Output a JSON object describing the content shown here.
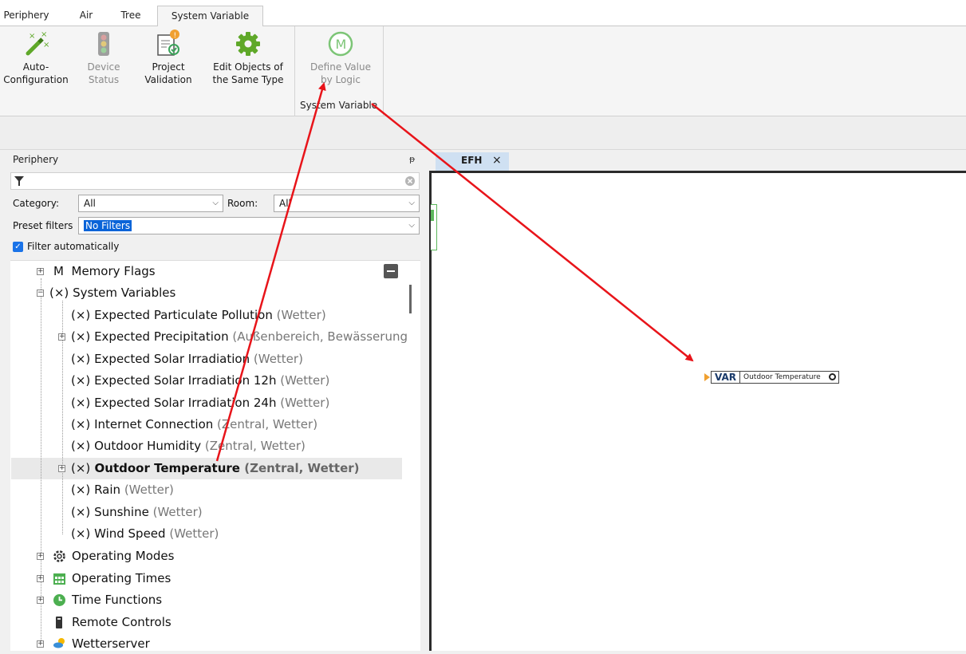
{
  "ribbon": {
    "tabs": [
      "Periphery",
      "Air",
      "Tree",
      "System Variable"
    ],
    "active_tab": "System Variable",
    "buttons": [
      {
        "label1": "Auto-",
        "label2": "Configuration",
        "icon": "magic-wand-icon",
        "enabled": true
      },
      {
        "label1": "Device",
        "label2": "Status",
        "icon": "traffic-light-icon",
        "enabled": false
      },
      {
        "label1": "Project",
        "label2": "Validation",
        "icon": "validation-icon",
        "enabled": true
      },
      {
        "label1": "Edit Objects of",
        "label2": "the Same Type",
        "icon": "gear-icon",
        "enabled": true
      },
      {
        "label1": "Define Value",
        "label2": "by Logic",
        "icon": "logic-m-icon",
        "enabled": false
      }
    ],
    "group_label": "System Variable",
    "colors": {
      "gear_green": "#5fa829",
      "logic_green": "#7cc576",
      "tab_highlight": "#cfe0f2"
    }
  },
  "periphery": {
    "title": "Periphery",
    "pin_icon": "pin-icon",
    "filter_icon": "funnel-icon",
    "clear_icon": "clear-circle-icon",
    "category_label": "Category:",
    "category_value": "All",
    "room_label": "Room:",
    "room_value": "All",
    "preset_label": "Preset filters",
    "preset_value": "No Filters",
    "filter_auto_label": "Filter automatically",
    "filter_auto_checked": true
  },
  "tree": {
    "memory_flags": "Memory Flags",
    "system_variables": "System Variables",
    "children": [
      {
        "name": "Expected Particulate Pollution",
        "ctx": "(Wetter)",
        "expandable": false
      },
      {
        "name": "Expected Precipitation",
        "ctx": "(Außenbereich, Bewässerung",
        "expandable": true
      },
      {
        "name": "Expected Solar Irradiation",
        "ctx": "(Wetter)",
        "expandable": false
      },
      {
        "name": "Expected Solar Irradiation 12h",
        "ctx": "(Wetter)",
        "expandable": false
      },
      {
        "name": "Expected Solar Irradiation 24h",
        "ctx": "(Wetter)",
        "expandable": false
      },
      {
        "name": "Internet Connection",
        "ctx": "(Zentral, Wetter)",
        "expandable": false
      },
      {
        "name": "Outdoor Humidity",
        "ctx": "(Zentral, Wetter)",
        "expandable": false
      },
      {
        "name": "Outdoor Temperature",
        "ctx": "(Zentral, Wetter)",
        "expandable": true,
        "selected": true
      },
      {
        "name": "Rain",
        "ctx": "(Wetter)",
        "expandable": false
      },
      {
        "name": "Sunshine",
        "ctx": "(Wetter)",
        "expandable": false
      },
      {
        "name": "Wind Speed",
        "ctx": "(Wetter)",
        "expandable": false
      }
    ],
    "var_prefix": "(×)",
    "memory_prefix": "M",
    "operating_modes": "Operating Modes",
    "operating_times": "Operating Times",
    "time_functions": "Time Functions",
    "remote_controls": "Remote Controls",
    "wetterserver": "Wetterserver"
  },
  "document": {
    "tab_label": "EFH",
    "close_glyph": "×",
    "block_key": "VAR",
    "block_name": "Outdoor Temperature"
  }
}
